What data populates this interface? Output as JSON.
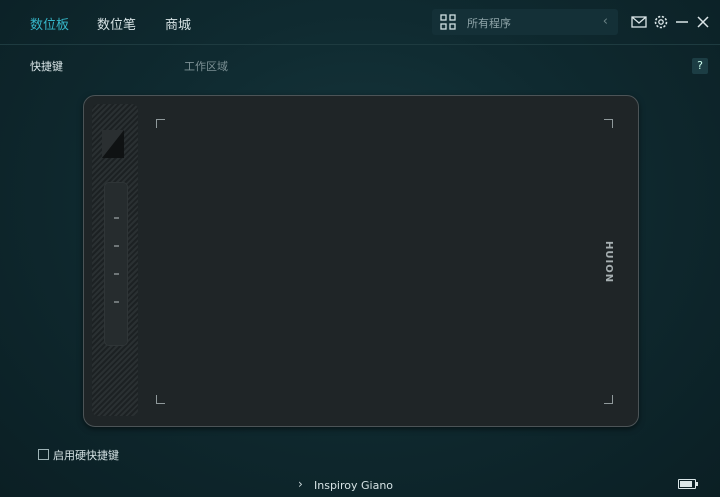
{
  "nav": {
    "tabs": [
      {
        "label": "数位板",
        "active": true
      },
      {
        "label": "数位笔",
        "active": false
      },
      {
        "label": "商城",
        "active": false
      }
    ]
  },
  "search": {
    "placeholder": "所有程序",
    "icon": "grid-icon"
  },
  "header_icons": [
    "mail-icon",
    "gear-icon",
    "minimize-icon",
    "close-icon"
  ],
  "subnav": {
    "shortcut_label": "快捷键",
    "work_area_label": "工作区域",
    "help_label": "?"
  },
  "tablet": {
    "brand_text": "HUION"
  },
  "options": {
    "enable_hw_shortcut_label": "启用硬快捷键",
    "enable_hw_shortcut_checked": false
  },
  "footer": {
    "device_name": "Inspiroy Giano",
    "battery_icon": "battery-icon"
  },
  "colors": {
    "accent": "#35b6c8",
    "background": "#0f2a30"
  }
}
